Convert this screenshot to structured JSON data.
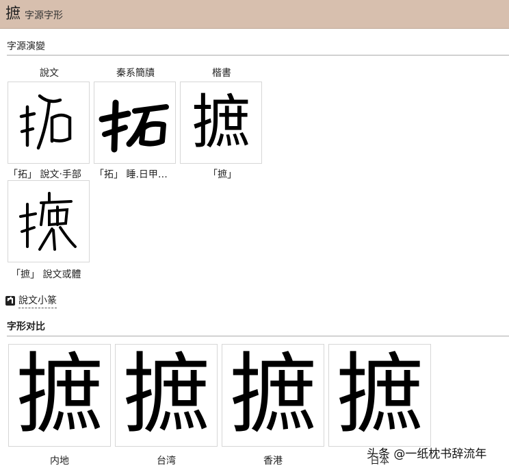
{
  "header": {
    "char": "摭",
    "subtitle": "字源字形"
  },
  "section1": {
    "title": "字源演變"
  },
  "columns": [
    "說文",
    "秦系簡牘",
    "楷書"
  ],
  "glyph_boxes": [
    {
      "caption": "「拓」 說文‧手部"
    },
    {
      "caption": "「拓」 睡.日甲…"
    },
    {
      "caption": "「摭」",
      "kaishu_char": "摭"
    },
    {
      "caption": "「摭」 說文或體"
    }
  ],
  "link": {
    "label": "說文小篆"
  },
  "section2": {
    "title": "字形对比"
  },
  "comparison": [
    {
      "char": "摭",
      "region": "内地"
    },
    {
      "char": "摭",
      "region": "台湾"
    },
    {
      "char": "摭",
      "region": "香港"
    },
    {
      "char": "摭",
      "region": "日本"
    }
  ],
  "watermark": "头条 @一纸枕书辞流年"
}
